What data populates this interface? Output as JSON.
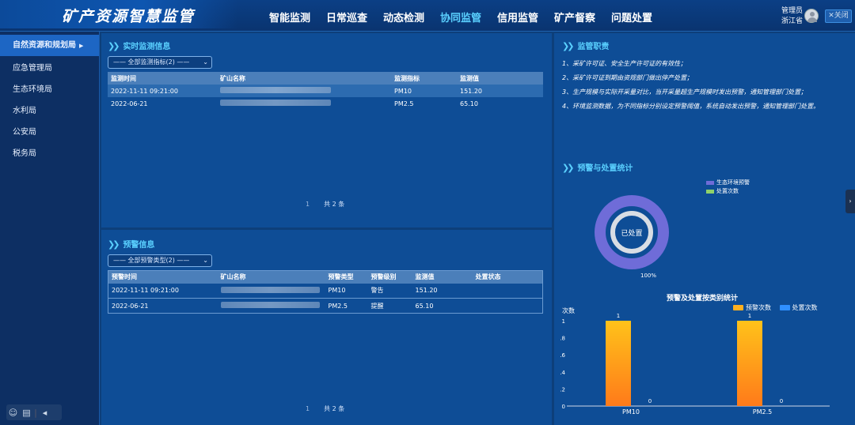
{
  "header": {
    "title": "矿产资源智慧监管",
    "nav": [
      "智能监测",
      "日常巡查",
      "动态检测",
      "协同监管",
      "信用监管",
      "矿产督察",
      "问题处置"
    ],
    "active_nav": "协同监管",
    "user_role": "管理员",
    "user_name": "浙江省",
    "close_label": "✕关闭"
  },
  "sidebar": {
    "items": [
      {
        "label": "自然资源和规划局"
      },
      {
        "label": "应急管理局"
      },
      {
        "label": "生态环境局"
      },
      {
        "label": "水利局"
      },
      {
        "label": "公安局"
      },
      {
        "label": "税务局"
      }
    ],
    "active_index": 0
  },
  "realtime": {
    "title": "实时监测信息",
    "filter": "—— 全部监测指标(2) ——",
    "columns": [
      "监测时间",
      "矿山名称",
      "监测指标",
      "监测值"
    ],
    "rows": [
      {
        "time": "2022-11-11 09:21:00",
        "indicator": "PM10",
        "value": "151.20"
      },
      {
        "time": "2022-06-21",
        "indicator": "PM2.5",
        "value": "65.10"
      }
    ],
    "pager_page": "1",
    "pager_total": "共 2 条"
  },
  "warning": {
    "title": "预警信息",
    "filter": "—— 全部预警类型(2) ——",
    "columns": [
      "预警时间",
      "矿山名称",
      "预警类型",
      "预警级别",
      "监测值",
      "处置状态"
    ],
    "rows": [
      {
        "time": "2022-11-11 09:21:00",
        "type": "PM10",
        "level": "警告",
        "value": "151.20",
        "status": ""
      },
      {
        "time": "2022-06-21",
        "type": "PM2.5",
        "level": "提醒",
        "value": "65.10",
        "status": ""
      }
    ],
    "pager_page": "1",
    "pager_total": "共 2 条"
  },
  "duties": {
    "title": "监管职责",
    "items": [
      "1、采矿许可证、安全生产许可证的有效性；",
      "2、采矿许可证到期由资规部门做出停产处置；",
      "3、生产规模与实际开采量对比，当开采量超生产规模时发出预警，通知管理部门处置；",
      "4、环境监测数据，为不同指标分别设定预警阈值，系统自动发出预警，通知管理部门处置。"
    ]
  },
  "stats": {
    "title": "预警与处置统计",
    "legend": [
      {
        "name": "生态环境预警",
        "color": "#6f6cd8"
      },
      {
        "name": "处置次数",
        "color": "#8fd16a"
      }
    ],
    "donut_center": "已处置",
    "donut_percent": "100%"
  },
  "chart_data": {
    "type": "bar",
    "title": "预警及处置按类别统计",
    "ylabel": "次数",
    "categories": [
      "PM10",
      "PM2.5"
    ],
    "series": [
      {
        "name": "预警次数",
        "values": [
          1,
          1
        ],
        "color": "#ffb020"
      },
      {
        "name": "处置次数",
        "values": [
          0,
          0
        ],
        "color": "#2f8fff"
      }
    ],
    "yticks": [
      "0",
      ".2",
      ".4",
      ".6",
      ".8",
      "1"
    ],
    "ylim": [
      0,
      1
    ]
  }
}
